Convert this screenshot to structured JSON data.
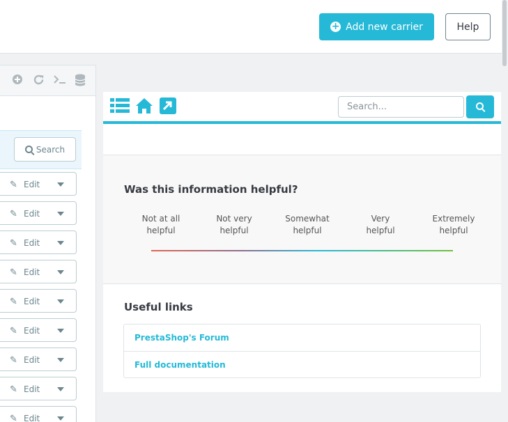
{
  "header": {
    "add_carrier_label": "Add new carrier",
    "help_label": "Help"
  },
  "list": {
    "search_button_label": "Search",
    "edit_label": "Edit",
    "edit_count": 9,
    "toolbar_icons": [
      "plus-circle-icon",
      "refresh-icon",
      "terminal-icon",
      "database-icon"
    ]
  },
  "help": {
    "nav_icons": [
      "list-icon",
      "home-icon",
      "external-link-icon"
    ],
    "search": {
      "placeholder": "Search...",
      "value": ""
    },
    "feedback": {
      "title": "Was this information helpful?",
      "options": [
        [
          "Not at all",
          "helpful"
        ],
        [
          "Not very",
          "helpful"
        ],
        [
          "Somewhat",
          "helpful"
        ],
        [
          "Very",
          "helpful"
        ],
        [
          "Extremely",
          "helpful"
        ]
      ]
    },
    "useful_links": {
      "title": "Useful links",
      "items": [
        "PrestaShop's Forum",
        "Full documentation"
      ]
    }
  },
  "colors": {
    "accent": "#25b9d7",
    "text": "#363a41",
    "muted": "#6c868e"
  }
}
